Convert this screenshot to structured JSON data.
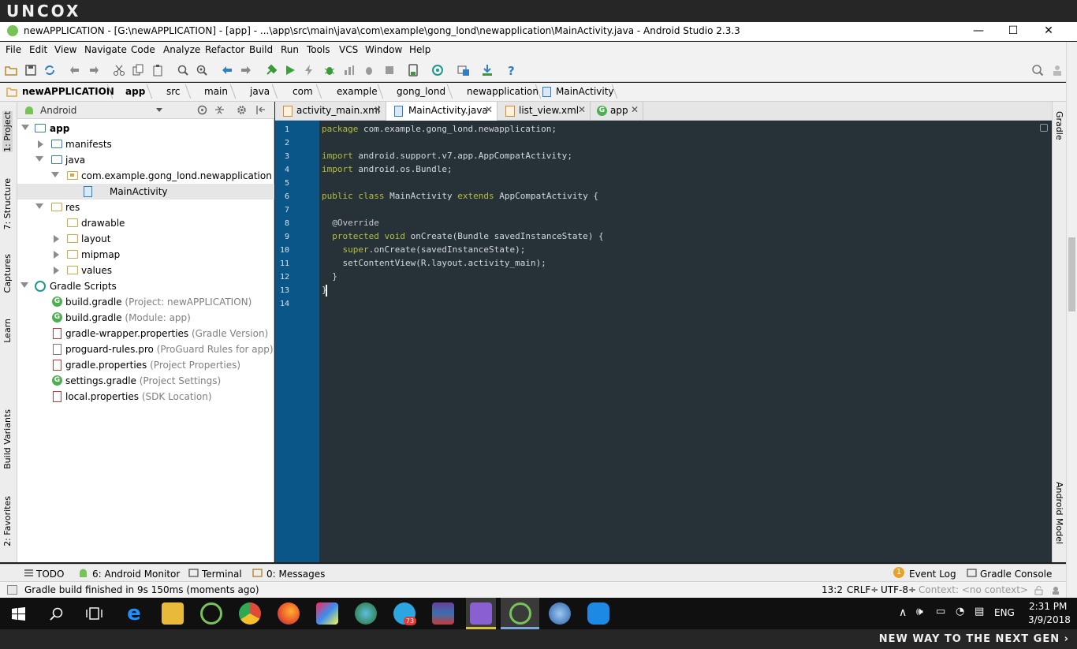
{
  "watermark": {
    "logo": "UNCOX",
    "tagline": "NEW WAY TO THE NEXT GEN ›"
  },
  "window": {
    "title": "newAPPLICATION - [G:\\newAPPLICATION] - [app] - ...\\app\\src\\main\\java\\com\\example\\gong_lond\\newapplication\\MainActivity.java - Android Studio 2.3.3",
    "minimize": "—",
    "maximize": "☐",
    "close": "✕"
  },
  "menu": [
    "File",
    "Edit",
    "View",
    "Navigate",
    "Code",
    "Analyze",
    "Refactor",
    "Build",
    "Run",
    "Tools",
    "VCS",
    "Window",
    "Help"
  ],
  "breadcrumb": [
    "newAPPLICATION",
    "app",
    "src",
    "main",
    "java",
    "com",
    "example",
    "gong_lond",
    "newapplication",
    "MainActivity"
  ],
  "left_stripe": [
    "1: Project",
    "7: Structure",
    "Captures",
    "Learn",
    "Build Variants",
    "2: Favorites"
  ],
  "right_stripe": [
    "Gradle",
    "Android Model"
  ],
  "project_panel": {
    "view": "Android",
    "tree": [
      {
        "label": "app",
        "bold": true
      },
      {
        "label": "manifests"
      },
      {
        "label": "java"
      },
      {
        "label": "com.example.gong_lond.newapplication"
      },
      {
        "label": "MainActivity"
      },
      {
        "label": "res"
      },
      {
        "label": "drawable"
      },
      {
        "label": "layout"
      },
      {
        "label": "mipmap"
      },
      {
        "label": "values"
      },
      {
        "label": "Gradle Scripts"
      },
      {
        "label": "build.gradle",
        "hint": "(Project: newAPPLICATION)"
      },
      {
        "label": "build.gradle",
        "hint": "(Module: app)"
      },
      {
        "label": "gradle-wrapper.properties",
        "hint": "(Gradle Version)"
      },
      {
        "label": "proguard-rules.pro",
        "hint": "(ProGuard Rules for app)"
      },
      {
        "label": "gradle.properties",
        "hint": "(Project Properties)"
      },
      {
        "label": "settings.gradle",
        "hint": "(Project Settings)"
      },
      {
        "label": "local.properties",
        "hint": "(SDK Location)"
      }
    ]
  },
  "tabs": [
    "activity_main.xml",
    "MainActivity.java",
    "list_view.xml",
    "app"
  ],
  "tab_close": "✕",
  "editor": {
    "line_numbers": [
      "1",
      "2",
      "3",
      "4",
      "5",
      "6",
      "7",
      "8",
      "9",
      "10",
      "11",
      "12",
      "13",
      "14"
    ],
    "lines": [
      "package com.example.gong_lond.newapplication;",
      "",
      "import android.support.v7.app.AppCompatActivity;",
      "import android.os.Bundle;",
      "",
      "public class MainActivity extends AppCompatActivity {",
      "",
      "  @Override",
      "  protected void onCreate(Bundle savedInstanceState) {",
      "    super.onCreate(savedInstanceState);",
      "    setContentView(R.layout.activity_main);",
      "  }",
      "}",
      ""
    ]
  },
  "bottom_tools": {
    "todo": "TODO",
    "android_monitor": "6: Android Monitor",
    "terminal": "Terminal",
    "messages": "0: Messages",
    "event_log": "Event Log",
    "event_count": "1",
    "gradle_console": "Gradle Console"
  },
  "status": {
    "message": "Gradle build finished in 9s 150ms (moments ago)",
    "position": "13:2",
    "line_sep": "CRLF÷",
    "encoding": "UTF-8÷",
    "context": "Context: <no context>"
  },
  "taskbar": {
    "telegram_badge": "73",
    "lang": "ENG",
    "time": "2:31 PM",
    "date": "3/9/2018"
  },
  "colors": {
    "editor_bg": "#263238",
    "gutter_bg": "#0b5689",
    "keyword": "#b6bd3f",
    "android_green": "#78c257"
  }
}
